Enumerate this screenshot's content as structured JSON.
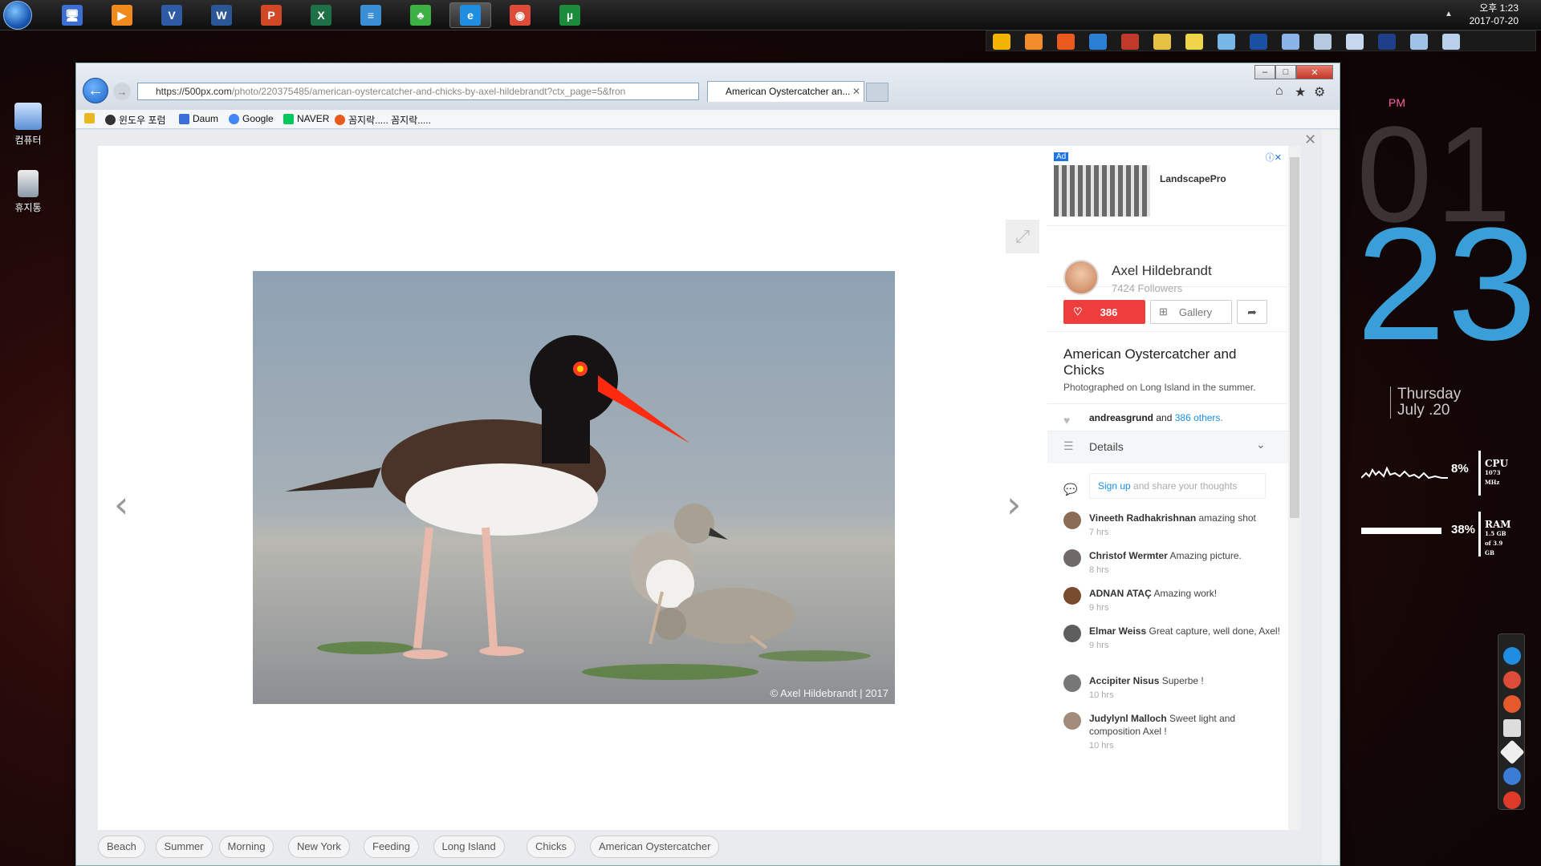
{
  "taskbar": {
    "apps": [
      {
        "name": "computer-app",
        "glyph": "🖥",
        "color": "#3c6fd1"
      },
      {
        "name": "media-player-app",
        "glyph": "▶",
        "color": "#f08a1d"
      },
      {
        "name": "visio-app",
        "glyph": "V",
        "color": "#2f5ba5"
      },
      {
        "name": "word-app",
        "glyph": "W",
        "color": "#2b5797"
      },
      {
        "name": "powerpoint-app",
        "glyph": "P",
        "color": "#d24726"
      },
      {
        "name": "excel-app",
        "glyph": "X",
        "color": "#1e7145"
      },
      {
        "name": "notepad-app",
        "glyph": "≡",
        "color": "#3a8fd4"
      },
      {
        "name": "clover-app",
        "glyph": "♣",
        "color": "#3cb043"
      },
      {
        "name": "ie-app",
        "glyph": "e",
        "color": "#1f8ee0"
      },
      {
        "name": "chrome-app",
        "glyph": "◉",
        "color": "#dd4b39"
      },
      {
        "name": "utorrent-app",
        "glyph": "µ",
        "color": "#1a8c3c"
      }
    ],
    "clock_time": "오후 1:23",
    "clock_date": "2017-07-20"
  },
  "desktop": {
    "icons": [
      {
        "label": "컴퓨터"
      },
      {
        "label": "휴지통"
      }
    ]
  },
  "browser": {
    "url_host": "https://500px.com",
    "url_path": "/photo/220375485/american-oystercatcher-and-chicks-by-axel-hildebrandt?ctx_page=5&fron",
    "tab_title": "American Oystercatcher an...",
    "favorites": [
      "윈도우 포럼",
      "Daum",
      "Google",
      "NAVER",
      "꼼지락..... 꼼지락....."
    ]
  },
  "photo": {
    "credit": "© Axel Hildebrandt | 2017"
  },
  "sidebar": {
    "ad_label": "Ad",
    "ad_title": "LandscapePro",
    "author": "Axel Hildebrandt",
    "followers": "7424 Followers",
    "likes": "386",
    "gallery_label": "Gallery",
    "title": "American Oystercatcher and Chicks",
    "description": "Photographed on Long Island in the summer.",
    "likers_name": "andreasgrund",
    "likers_and": " and ",
    "likers_others": "386 others.",
    "details_label": "Details",
    "signup_link": "Sign up",
    "signup_rest": " and share your thoughts",
    "comments": [
      {
        "name": "Vineeth Radhakrishnan",
        "text": "amazing shot",
        "time": "7 hrs"
      },
      {
        "name": "Christof Wermter",
        "text": "Amazing picture.",
        "time": "8 hrs"
      },
      {
        "name": "ADNAN ATAÇ",
        "text": "Amazing work!",
        "time": "9 hrs"
      },
      {
        "name": "Elmar Weiss",
        "text": "Great capture, well done, Axel!",
        "time": "9 hrs"
      },
      {
        "name": "Accipiter Nisus",
        "text": "Superbe !",
        "time": "10 hrs"
      },
      {
        "name": "Judylynl Malloch",
        "text": "Sweet light and composition Axel !",
        "time": "10 hrs"
      }
    ]
  },
  "tags": [
    "Beach",
    "Summer",
    "Morning",
    "New York",
    "Feeding",
    "Long Island",
    "Chicks",
    "American Oystercatcher"
  ],
  "widget": {
    "ampm": "PM",
    "hour": "01",
    "minute": "23",
    "weekday": "Thursday",
    "date": "July .20",
    "cpu_pct": "8%",
    "cpu_label": "CPU",
    "cpu_sub": "1073 MHz",
    "ram_pct": "38%",
    "ram_label": "RAM",
    "ram_sub1": "1.5 GB",
    "ram_sub2": "of 3.9 GB"
  }
}
